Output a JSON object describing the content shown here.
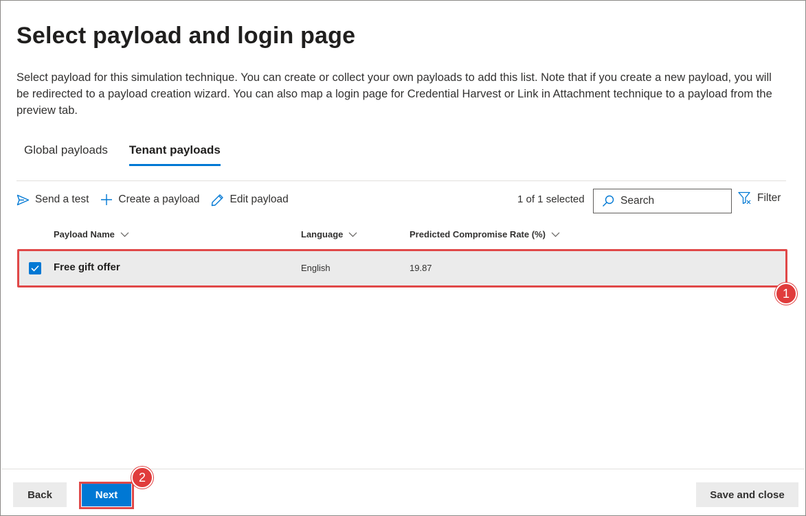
{
  "page": {
    "title": "Select payload and login page",
    "description": "Select payload for this simulation technique. You can create or collect your own payloads to add this list. Note that if you create a new payload, you will be redirected to a payload creation wizard. You can also map a login page for Credential Harvest or Link in Attachment technique to a payload from the preview tab."
  },
  "tabs": [
    {
      "label": "Global payloads",
      "active": false
    },
    {
      "label": "Tenant payloads",
      "active": true
    }
  ],
  "toolbar": {
    "send_test": "Send a test",
    "create_payload": "Create a payload",
    "edit_payload": "Edit payload",
    "selection_count": "1 of 1 selected",
    "search_placeholder": "Search",
    "filter": "Filter"
  },
  "table": {
    "columns": [
      "Payload Name",
      "Language",
      "Predicted Compromise Rate (%)"
    ],
    "rows": [
      {
        "name": "Free gift offer",
        "language": "English",
        "rate": "19.87",
        "selected": true
      }
    ]
  },
  "annotations": [
    "1",
    "2"
  ],
  "footer": {
    "back": "Back",
    "next": "Next",
    "save_close": "Save and close"
  },
  "colors": {
    "accent": "#0078d4",
    "annotation_red": "#e03c3c",
    "selected_row_bg": "#ebebeb"
  }
}
